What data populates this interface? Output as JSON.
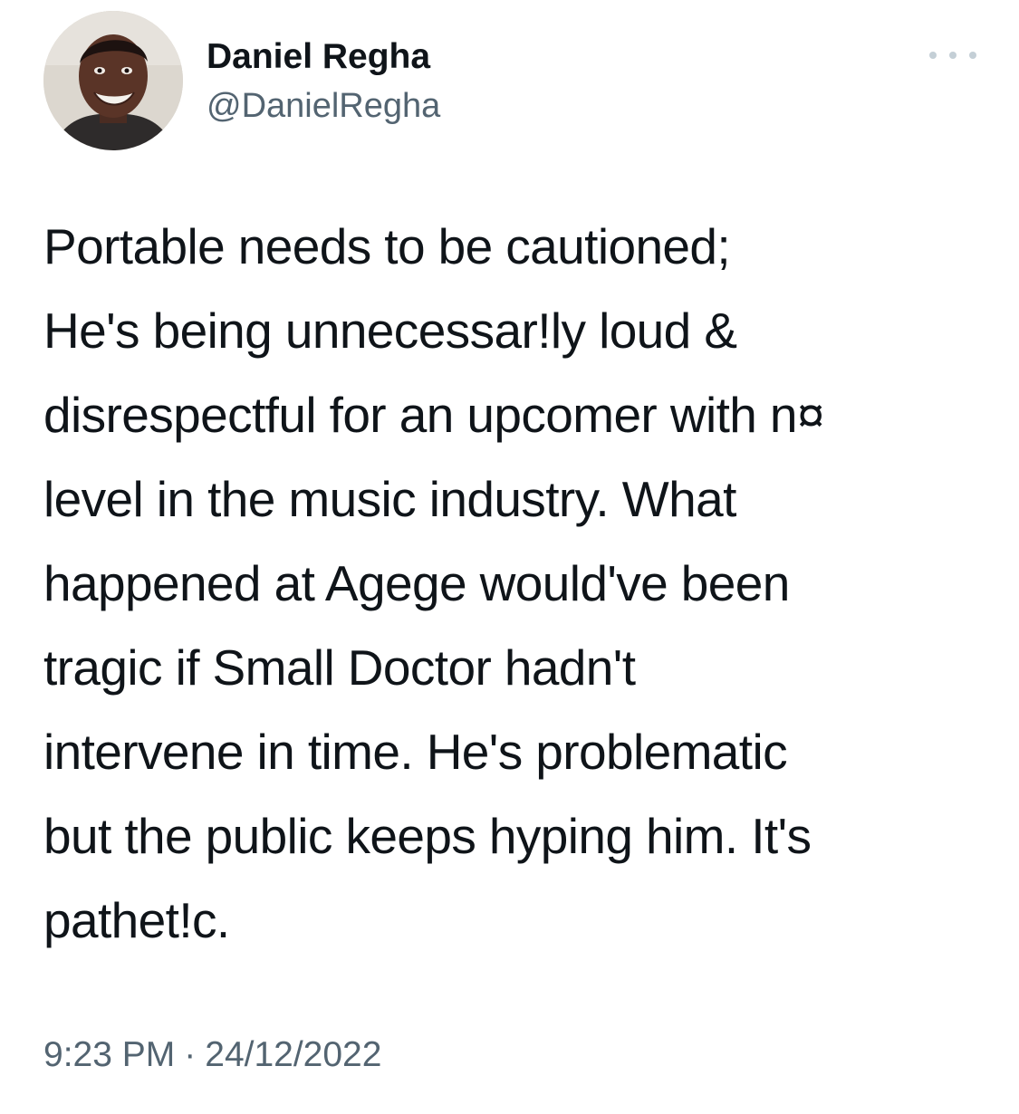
{
  "author": {
    "display_name": "Daniel Regha",
    "handle": "@DanielRegha",
    "avatar_icon": "profile-photo"
  },
  "more_icon": "ellipsis-icon",
  "tweet": {
    "text": "Portable needs to be cautioned;\nHe's being unnecessar!ly loud &\ndisrespectful for an upcomer with n¤\nlevel in the music industry. What\nhappened at Agege would've been\ntragic if Small Doctor hadn't\nintervene in time. He's problematic\nbut the public keeps hyping him. It's\npathet!c.",
    "time": "9:23 PM",
    "separator": "·",
    "date": "24/12/2022"
  },
  "colors": {
    "primary_text": "#0f1419",
    "secondary_text": "#536471",
    "icon_gray": "#c4cfd6",
    "background": "#ffffff"
  }
}
